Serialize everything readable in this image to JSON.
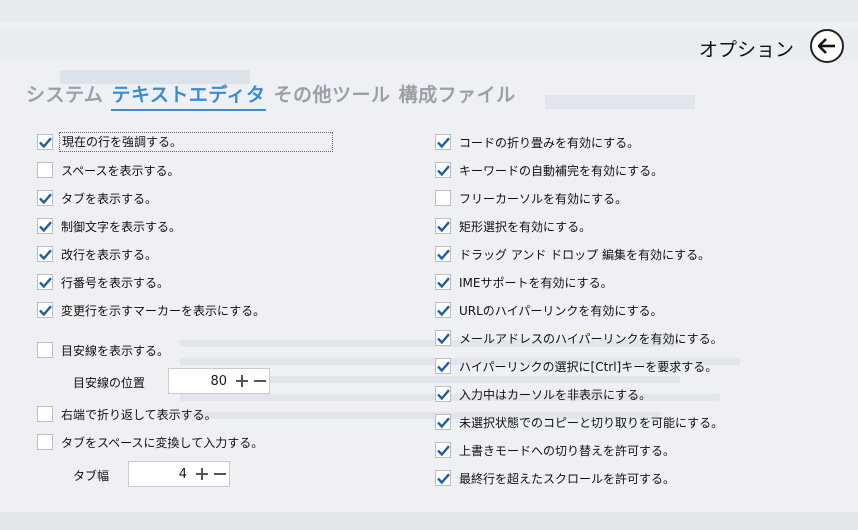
{
  "header": {
    "title": "オプション"
  },
  "tabs": [
    {
      "label": "システム",
      "active": false
    },
    {
      "label": "テキストエディタ",
      "active": true
    },
    {
      "label": "その他ツール",
      "active": false
    },
    {
      "label": "構成ファイル",
      "active": false
    }
  ],
  "left_options": [
    {
      "label": "現在の行を強調する。",
      "checked": true
    },
    {
      "label": "スペースを表示する。",
      "checked": false
    },
    {
      "label": "タブを表示する。",
      "checked": true
    },
    {
      "label": "制御文字を表示する。",
      "checked": true
    },
    {
      "label": "改行を表示する。",
      "checked": true
    },
    {
      "label": "行番号を表示する。",
      "checked": true
    },
    {
      "label": "変更行を示すマーカーを表示にする。",
      "checked": true
    },
    {
      "label": "目安線を表示する。",
      "checked": false
    },
    {
      "label": "右端で折り返して表示する。",
      "checked": false
    },
    {
      "label": "タブをスペースに変換して入力する。",
      "checked": false
    }
  ],
  "guideline_position": {
    "label": "目安線の位置",
    "value": "80"
  },
  "tab_width": {
    "label": "タブ幅",
    "value": "4"
  },
  "right_options": [
    {
      "label": "コードの折り畳みを有効にする。",
      "checked": true
    },
    {
      "label": "キーワードの自動補完を有効にする。",
      "checked": true
    },
    {
      "label": "フリーカーソルを有効にする。",
      "checked": false
    },
    {
      "label": "矩形選択を有効にする。",
      "checked": true
    },
    {
      "label": "ドラッグ アンド ドロップ 編集を有効にする。",
      "checked": true
    },
    {
      "label": "IMEサポートを有効にする。",
      "checked": true
    },
    {
      "label": "URLのハイパーリンクを有効にする。",
      "checked": true
    },
    {
      "label": "メールアドレスのハイパーリンクを有効にする。",
      "checked": true
    },
    {
      "label": "ハイパーリンクの選択に[Ctrl]キーを要求する。",
      "checked": true
    },
    {
      "label": "入力中はカーソルを非表示にする。",
      "checked": true
    },
    {
      "label": "未選択状態でのコピーと切り取りを可能にする。",
      "checked": true
    },
    {
      "label": "上書きモードへの切り替えを許可する。",
      "checked": true
    },
    {
      "label": "最終行を超えたスクロールを許可する。",
      "checked": true
    }
  ],
  "colors": {
    "accent": "#3b8bd6",
    "check": "#1f5fa8",
    "background": "#eef0f3"
  },
  "icons": {
    "back": "arrow-left-icon",
    "check": "checkmark-icon",
    "plus": "plus-icon",
    "minus": "minus-icon"
  }
}
